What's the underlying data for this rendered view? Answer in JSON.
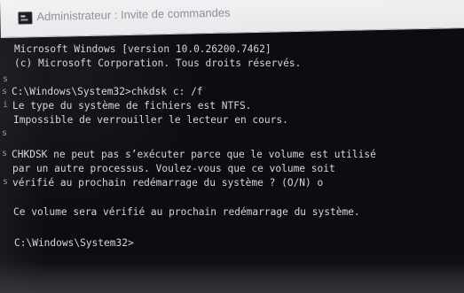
{
  "window": {
    "title": "Administrateur : Invite de commandes"
  },
  "console": {
    "lines": [
      "Microsoft Windows [version 10.0.26200.7462]",
      "(c) Microsoft Corporation. Tous droits réservés.",
      "C:\\Windows\\System32>chkdsk c: /f",
      "Le type du système de fichiers est NTFS.",
      "Impossible de verrouiller le lecteur en cours.",
      "CHKDSK ne peut pas s’exécuter parce que le volume est utilisé",
      "par un autre processus. Voulez-vous que ce volume soit",
      "vérifié au prochain redémarrage du système ? (O/N) o",
      "Ce volume sera vérifié au prochain redémarrage du système.",
      "C:\\Windows\\System32>"
    ]
  },
  "decor": {
    "margin_marks": [
      "s",
      "s",
      "i",
      "s",
      "s",
      "s"
    ]
  },
  "colors": {
    "background": "#0c0d11",
    "titlebar": "#f2f2f4",
    "text": "#d5d5db"
  }
}
